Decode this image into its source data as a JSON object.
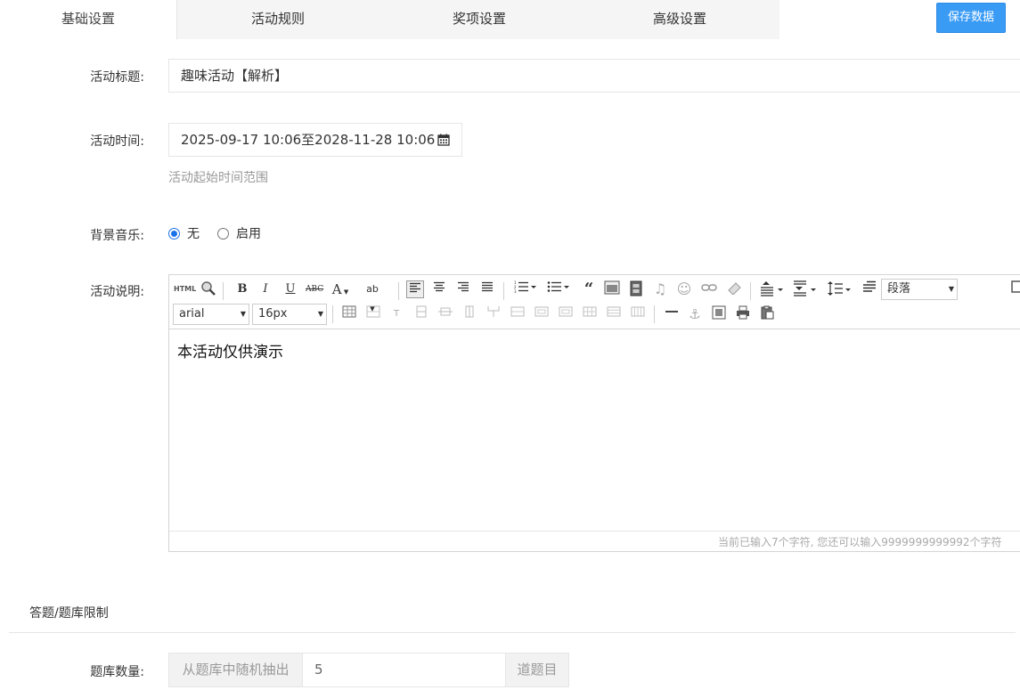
{
  "tabs": [
    {
      "label": "基础设置",
      "active": true
    },
    {
      "label": "活动规则"
    },
    {
      "label": "奖项设置"
    },
    {
      "label": "高级设置"
    }
  ],
  "save_button": "保存数据",
  "form": {
    "title_label": "活动标题:",
    "title_value": "趣味活动【解析】",
    "time_label": "活动时间:",
    "time_value": "2025-09-17 10:06至2028-11-28 10:06",
    "time_hint": "活动起始时间范围",
    "music_label": "背景音乐:",
    "music_options": [
      "无",
      "启用"
    ],
    "music_selected": "无",
    "desc_label": "活动说明:"
  },
  "editor": {
    "source_label": "HTML",
    "font_family": "arial",
    "font_size": "16px",
    "paragraph": "段落",
    "content": "本活动仅供演示",
    "word_count_text": "当前已输入7个字符, 您还可以输入9999999999992个字符"
  },
  "section": {
    "title": "答题/题库限制"
  },
  "question_bank": {
    "label": "题库数量:",
    "prefix": "从题库中随机抽出",
    "value": "5",
    "suffix": "道题目"
  },
  "colors": {
    "primary": "#3a9bf5",
    "radio_on": "#1a73e8"
  }
}
